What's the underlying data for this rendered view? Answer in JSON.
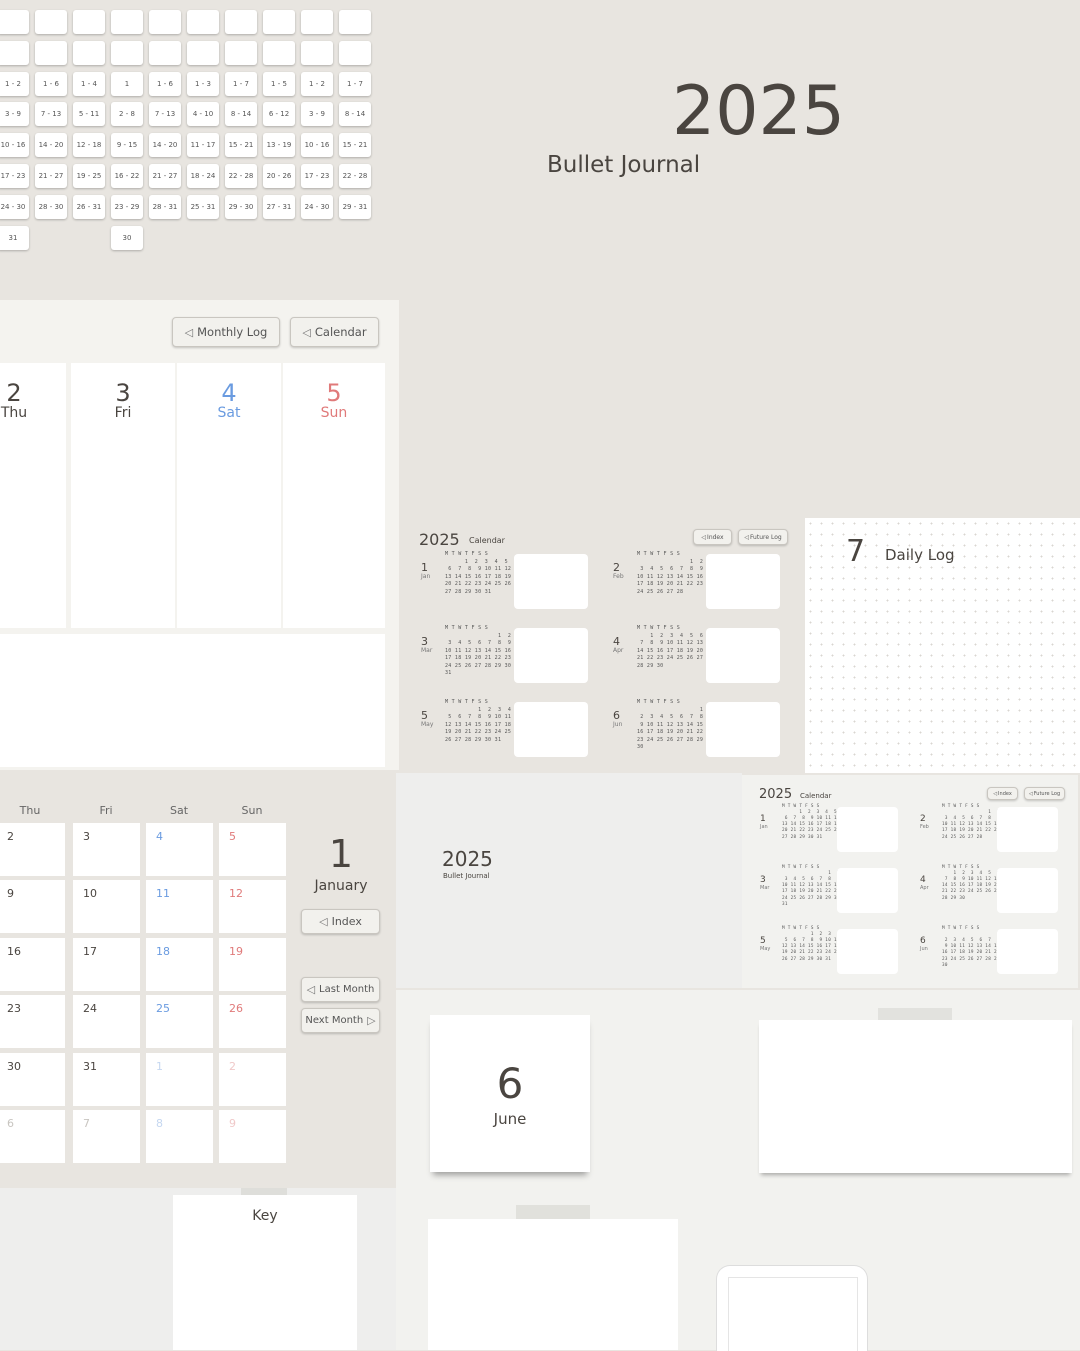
{
  "week_ranges": [
    [
      "",
      "",
      "",
      "",
      "",
      "",
      "",
      "",
      "",
      ""
    ],
    [
      "",
      "",
      "",
      "",
      "",
      "",
      "",
      "",
      "",
      ""
    ],
    [
      "1 - 2",
      "1 - 6",
      "1 - 4",
      "1",
      "1 - 6",
      "1 - 3",
      "1 - 7",
      "1 - 5",
      "1 - 2",
      "1 - 7"
    ],
    [
      "3 - 9",
      "7 - 13",
      "5 - 11",
      "2 - 8",
      "7 - 13",
      "4 - 10",
      "8 - 14",
      "6 - 12",
      "3 - 9",
      "8 - 14"
    ],
    [
      "10 - 16",
      "14 - 20",
      "12 - 18",
      "9 - 15",
      "14 - 20",
      "11 - 17",
      "15 - 21",
      "13 - 19",
      "10 - 16",
      "15 - 21"
    ],
    [
      "17 - 23",
      "21 - 27",
      "19 - 25",
      "16 - 22",
      "21 - 27",
      "18 - 24",
      "22 - 28",
      "20 - 26",
      "17 - 23",
      "22 - 28"
    ],
    [
      "24 - 30",
      "28 - 30",
      "26 - 31",
      "23 - 29",
      "28 - 31",
      "25 - 31",
      "29 - 30",
      "27 - 31",
      "24 - 30",
      "29 - 31"
    ],
    [
      "31",
      "",
      "",
      "30",
      "",
      "",
      "",
      "",
      "",
      ""
    ]
  ],
  "cover": {
    "year": "2025",
    "title": "Bullet Journal"
  },
  "weekly": {
    "buttons": {
      "monthly_log": "Monthly Log",
      "calendar": "Calendar"
    },
    "days": [
      {
        "num": "2",
        "name": "Thu"
      },
      {
        "num": "3",
        "name": "Fri"
      },
      {
        "num": "4",
        "name": "Sat"
      },
      {
        "num": "5",
        "name": "Sun"
      }
    ]
  },
  "calendar_page": {
    "year": "2025",
    "label": "Calendar",
    "buttons": {
      "index": "Index",
      "future_log": "Future Log"
    },
    "months": [
      {
        "num": "1",
        "abbr": "Jan"
      },
      {
        "num": "2",
        "abbr": "Feb"
      },
      {
        "num": "3",
        "abbr": "Mar"
      },
      {
        "num": "4",
        "abbr": "Apr"
      },
      {
        "num": "5",
        "abbr": "May"
      },
      {
        "num": "6",
        "abbr": "Jun"
      }
    ]
  },
  "daily_log": {
    "num": "7",
    "title": "Daily Log"
  },
  "month_view": {
    "headers": [
      "Thu",
      "Fri",
      "Sat",
      "Sun"
    ],
    "rows": [
      [
        "2",
        "3",
        "4",
        "5"
      ],
      [
        "9",
        "10",
        "11",
        "12"
      ],
      [
        "16",
        "17",
        "18",
        "19"
      ],
      [
        "23",
        "24",
        "25",
        "26"
      ],
      [
        "30",
        "31",
        "1",
        "2"
      ],
      [
        "6",
        "7",
        "8",
        "9"
      ]
    ],
    "month_num": "1",
    "month_name": "January",
    "buttons": {
      "index": "Index",
      "last_month": "Last Month",
      "next_month": "Next Month"
    }
  },
  "small_cover": {
    "year": "2025",
    "title": "Bullet Journal"
  },
  "small_calendar": {
    "year": "2025",
    "label": "Calendar",
    "buttons": {
      "index": "Index",
      "future_log": "Future Log"
    },
    "months": [
      {
        "num": "1",
        "abbr": "Jan"
      },
      {
        "num": "2",
        "abbr": "Feb"
      },
      {
        "num": "3",
        "abbr": "Mar"
      },
      {
        "num": "4",
        "abbr": "Apr"
      },
      {
        "num": "5",
        "abbr": "May"
      },
      {
        "num": "6",
        "abbr": "Jun"
      }
    ]
  },
  "june_card": {
    "num": "6",
    "name": "June"
  },
  "key_card": {
    "title": "Key"
  },
  "mini_month_rows": {
    "header": "M T W T F S S",
    "jan": [
      "      1  2  3  4  5",
      " 6  7  8  9 10 11 12",
      "13 14 15 16 17 18 19",
      "20 21 22 23 24 25 26",
      "27 28 29 30 31"
    ],
    "feb": [
      "                1  2",
      " 3  4  5  6  7  8  9",
      "10 11 12 13 14 15 16",
      "17 18 19 20 21 22 23",
      "24 25 26 27 28"
    ],
    "mar": [
      "                1  2",
      " 3  4  5  6  7  8  9",
      "10 11 12 13 14 15 16",
      "17 18 19 20 21 22 23",
      "24 25 26 27 28 29 30",
      "31"
    ],
    "apr": [
      "    1  2  3  4  5  6",
      " 7  8  9 10 11 12 13",
      "14 15 16 17 18 19 20",
      "21 22 23 24 25 26 27",
      "28 29 30"
    ],
    "may": [
      "          1  2  3  4",
      " 5  6  7  8  9 10 11",
      "12 13 14 15 16 17 18",
      "19 20 21 22 23 24 25",
      "26 27 28 29 30 31"
    ],
    "jun": [
      "                   1",
      " 2  3  4  5  6  7  8",
      " 9 10 11 12 13 14 15",
      "16 17 18 19 20 21 22",
      "23 24 25 26 27 28 29",
      "30"
    ]
  },
  "colors": {
    "saturday": "#6a9be0",
    "sunday": "#e07a7a",
    "text": "#4a4540",
    "bg": "#e8e5e0"
  }
}
